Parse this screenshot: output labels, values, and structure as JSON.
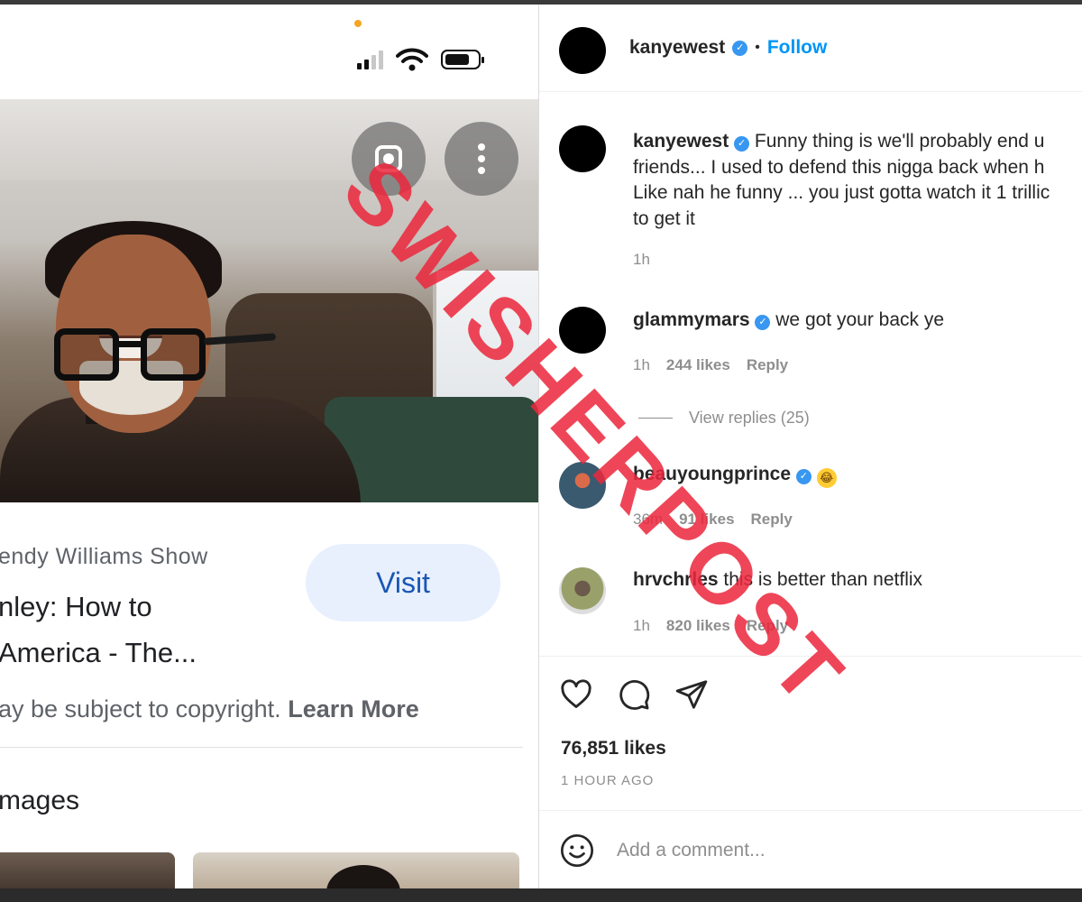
{
  "left_panel": {
    "result": {
      "source": "endy Williams Show",
      "title_line1": "nley: How to",
      "title_line2": "America - The...",
      "visit_label": "Visit",
      "copyright_prefix": "ay be subject to copyright.",
      "learn_more": "Learn More",
      "images_heading": "mages"
    }
  },
  "post": {
    "author": "kanyewest",
    "follow_label": "Follow",
    "caption": "Funny thing is we'll probably end u\nfriends... I used to defend this nigga back when h\nLike nah he funny ... you just gotta watch it 1 trillic\nto get it",
    "caption_time": "1h",
    "comments": [
      {
        "user": "glammymars",
        "verified": true,
        "text": "we got your back ye",
        "time": "1h",
        "likes": "244 likes",
        "reply": "Reply",
        "view_replies": "View replies (25)"
      },
      {
        "user": "beauyoungprince",
        "verified": true,
        "text": "😂",
        "time": "36m",
        "likes": "91 likes",
        "reply": "Reply"
      },
      {
        "user": "hrvchrles",
        "verified": false,
        "text": "this is better than netflix",
        "time": "1h",
        "likes": "820 likes",
        "reply": "Reply"
      }
    ],
    "like_count": "76,851 likes",
    "posted_ago": "1 HOUR AGO",
    "add_comment_placeholder": "Add a comment..."
  },
  "watermark": "SWISHERPOST",
  "colors": {
    "follow": "#0095f6",
    "verified": "#3897f0",
    "watermark": "#eb283c",
    "visit_bg": "#e8f0fe",
    "visit_text": "#1a56b4"
  },
  "icons": [
    "signal-icon",
    "wifi-icon",
    "battery-icon",
    "lens-icon",
    "more-vert-icon",
    "verified-icon",
    "heart-icon",
    "comment-icon",
    "share-icon",
    "emoji-icon"
  ]
}
